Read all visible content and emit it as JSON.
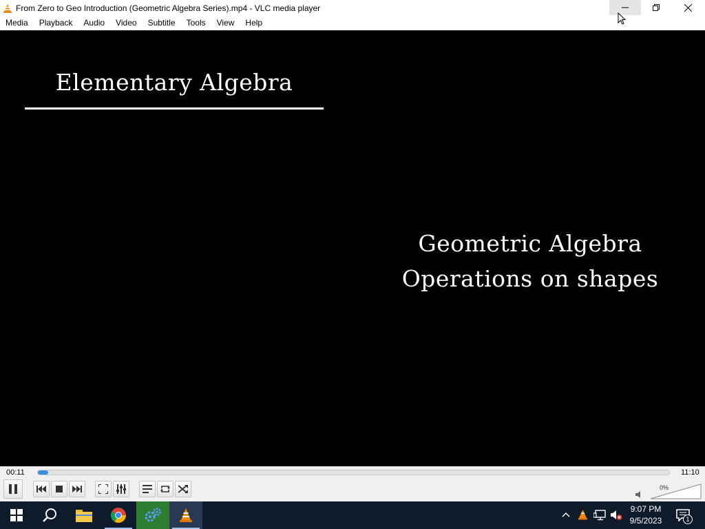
{
  "window": {
    "title": "From Zero to Geo Introduction (Geometric Algebra Series).mp4 - VLC media player",
    "app_icon": "vlc-cone-icon"
  },
  "menu": [
    "Media",
    "Playback",
    "Audio",
    "Video",
    "Subtitle",
    "Tools",
    "View",
    "Help"
  ],
  "video": {
    "heading": "Elementary Algebra",
    "line1": "Geometric Algebra",
    "line2": "Operations on shapes"
  },
  "playback": {
    "current_time": "00:11",
    "total_time": "11:10",
    "progress_fraction": 0.016,
    "volume": "0%"
  },
  "controls": [
    "pause-icon",
    "previous-icon",
    "stop-icon",
    "next-icon",
    "fullscreen-icon",
    "extended-settings-icon",
    "playlist-icon",
    "loop-icon",
    "shuffle-icon",
    "mute-icon"
  ],
  "taskbar": {
    "apps": [
      "windows-start-icon",
      "search-icon",
      "file-explorer-icon",
      "chrome-icon",
      "settings-gear-icon",
      "vlc-icon"
    ],
    "time": "9:07 PM",
    "date": "9/5/2023",
    "notification_count": "1"
  },
  "colors": {
    "accent": "#3b8de0",
    "taskbar": "#0f1a2a",
    "vlc_orange": "#f08a00"
  }
}
